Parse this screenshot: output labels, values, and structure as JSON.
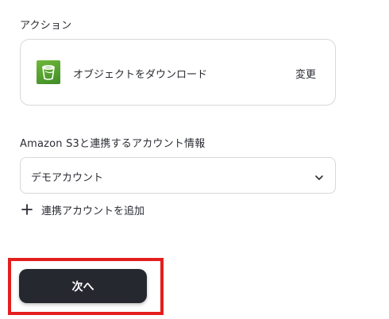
{
  "action_section": {
    "label": "アクション",
    "action_name": "オブジェクトをダウンロード",
    "change_label": "変更",
    "icon": "s3-bucket-icon"
  },
  "account_section": {
    "label": "Amazon S3と連携するアカウント情報",
    "selected_account": "デモアカウント",
    "add_account_label": "連携アカウントを追加"
  },
  "footer": {
    "next_label": "次へ"
  },
  "colors": {
    "button_bg": "#25282f",
    "highlight": "#e41e1e",
    "s3_green": "#4f9e2d",
    "border": "#d6d8dc"
  }
}
